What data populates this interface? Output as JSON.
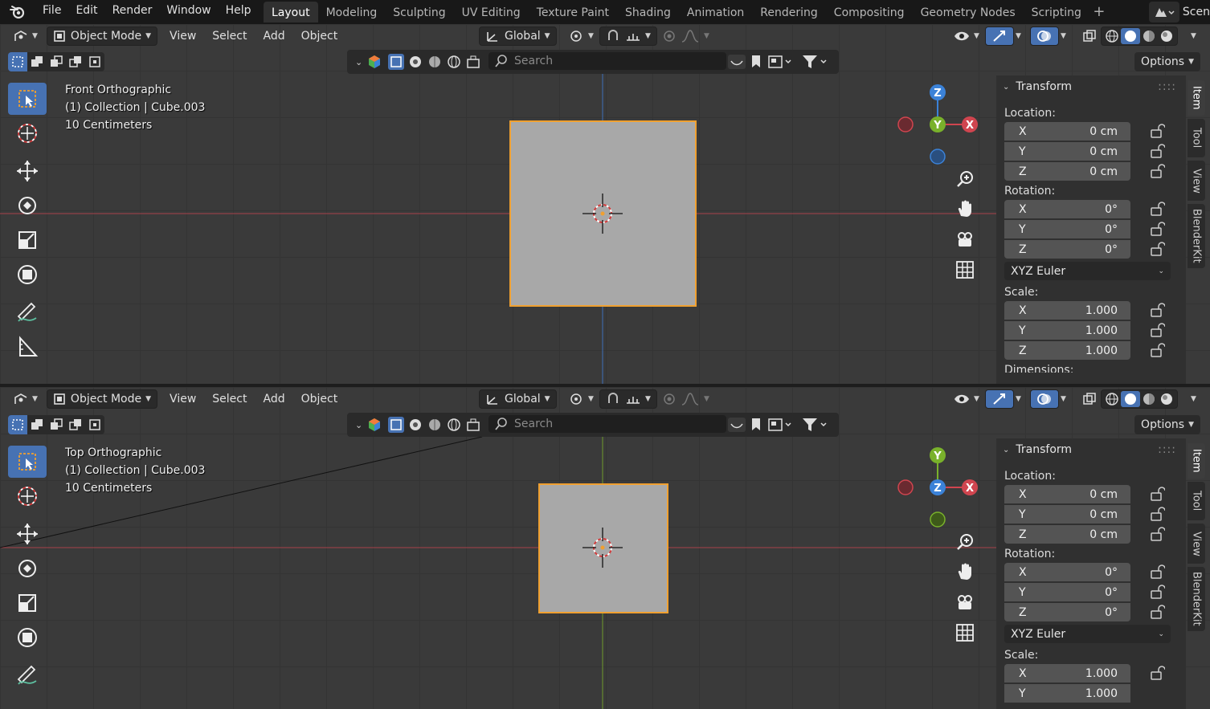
{
  "menubar": {
    "items": [
      "File",
      "Edit",
      "Render",
      "Window",
      "Help"
    ],
    "workspaces": [
      "Layout",
      "Modeling",
      "Sculpting",
      "UV Editing",
      "Texture Paint",
      "Shading",
      "Animation",
      "Rendering",
      "Compositing",
      "Geometry Nodes",
      "Scripting"
    ],
    "active_workspace": "Layout",
    "scene_label": "Scen"
  },
  "header": {
    "mode": "Object Mode",
    "menus": [
      "View",
      "Select",
      "Add",
      "Object"
    ],
    "orientation": "Global",
    "search_placeholder": "Search",
    "options": "Options"
  },
  "viewports": [
    {
      "view_name": "Front Orthographic",
      "collection": "(1) Collection | Cube.003",
      "scale": "10 Centimeters",
      "gizmo": {
        "top": "Z",
        "center": "Y",
        "right": "X"
      }
    },
    {
      "view_name": "Top Orthographic",
      "collection": "(1) Collection | Cube.003",
      "scale": "10 Centimeters",
      "gizmo": {
        "top": "Y",
        "center": "Z",
        "right": "X"
      }
    }
  ],
  "panel": {
    "title": "Transform",
    "location_label": "Location:",
    "rotation_label": "Rotation:",
    "scale_label": "Scale:",
    "dimensions_label": "Dimensions:",
    "axes": [
      "X",
      "Y",
      "Z"
    ],
    "location": [
      "0 cm",
      "0 cm",
      "0 cm"
    ],
    "rotation": [
      "0°",
      "0°",
      "0°"
    ],
    "rotation_mode": "XYZ Euler",
    "scale": [
      "1.000",
      "1.000",
      "1.000"
    ]
  },
  "side_tabs": [
    "Item",
    "Tool",
    "View",
    "BlenderKit"
  ],
  "colors": {
    "accent": "#4772b3",
    "selection_outline": "#f0a030",
    "x_axis": "#d0454f",
    "y_axis": "#79b12b",
    "z_axis": "#3b82d8"
  }
}
